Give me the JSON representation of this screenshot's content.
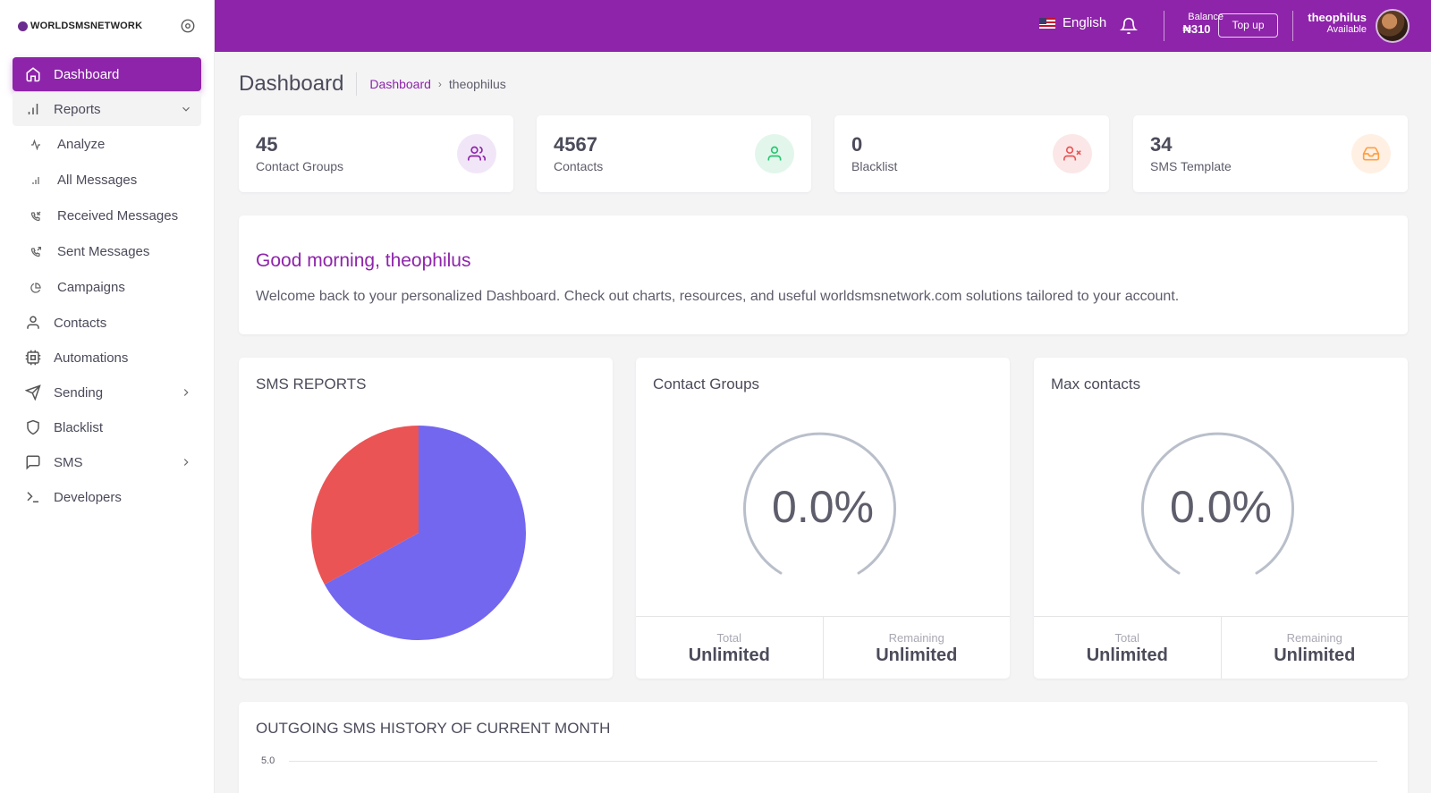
{
  "brand": {
    "name": "WORLDSMSNETWORK"
  },
  "sidebar": {
    "items": [
      {
        "label": "Dashboard",
        "icon": "home-icon"
      },
      {
        "label": "Reports",
        "icon": "bar-chart-icon"
      },
      {
        "label": "Analyze",
        "icon": "activity-icon"
      },
      {
        "label": "All Messages",
        "icon": "bar-chart-icon"
      },
      {
        "label": "Received Messages",
        "icon": "phone-incoming-icon"
      },
      {
        "label": "Sent Messages",
        "icon": "phone-outgoing-icon"
      },
      {
        "label": "Campaigns",
        "icon": "pie-chart-icon"
      },
      {
        "label": "Contacts",
        "icon": "user-icon"
      },
      {
        "label": "Automations",
        "icon": "cpu-icon"
      },
      {
        "label": "Sending",
        "icon": "send-icon"
      },
      {
        "label": "Blacklist",
        "icon": "shield-icon"
      },
      {
        "label": "SMS",
        "icon": "message-square-icon"
      },
      {
        "label": "Developers",
        "icon": "terminal-icon"
      }
    ]
  },
  "topbar": {
    "language": "English",
    "balance_label": "Balance",
    "balance_amount": "₦310",
    "topup_label": "Top up",
    "user_name": "theophilus",
    "user_status": "Available"
  },
  "page": {
    "title": "Dashboard",
    "breadcrumb": [
      "Dashboard",
      "theophilus"
    ]
  },
  "stats": [
    {
      "value": "45",
      "label": "Contact Groups",
      "icon": "users-icon",
      "color": "#8e24aa",
      "bg": "#f1e6f7"
    },
    {
      "value": "4567",
      "label": "Contacts",
      "icon": "user-icon",
      "color": "#28c76f",
      "bg": "#e2f6ec"
    },
    {
      "value": "0",
      "label": "Blacklist",
      "icon": "user-x-icon",
      "color": "#ea5455",
      "bg": "#fbe7e7"
    },
    {
      "value": "34",
      "label": "SMS Template",
      "icon": "inbox-icon",
      "color": "#ff9f43",
      "bg": "#fff0e3"
    }
  ],
  "welcome": {
    "greeting": "Good morning, theophilus",
    "message": "Welcome back to your personalized Dashboard. Check out charts, resources, and useful worldsmsnetwork.com solutions tailored to your account."
  },
  "sms_reports": {
    "title": "SMS REPORTS"
  },
  "chart_data": [
    {
      "type": "pie",
      "title": "SMS REPORTS",
      "slices": [
        {
          "value": 67,
          "color": "#7367f0"
        },
        {
          "value": 33,
          "color": "#ea5455"
        }
      ]
    },
    {
      "type": "line",
      "title": "OUTGOING SMS HISTORY OF CURRENT MONTH",
      "y_ticks": [
        "5.0"
      ]
    }
  ],
  "gauges": [
    {
      "title": "Contact Groups",
      "value": "0.0%",
      "total_label": "Total",
      "total_value": "Unlimited",
      "remaining_label": "Remaining",
      "remaining_value": "Unlimited"
    },
    {
      "title": "Max contacts",
      "value": "0.0%",
      "total_label": "Total",
      "total_value": "Unlimited",
      "remaining_label": "Remaining",
      "remaining_value": "Unlimited"
    }
  ],
  "history": {
    "title": "OUTGOING SMS HISTORY OF CURRENT MONTH",
    "y_tick": "5.0"
  }
}
